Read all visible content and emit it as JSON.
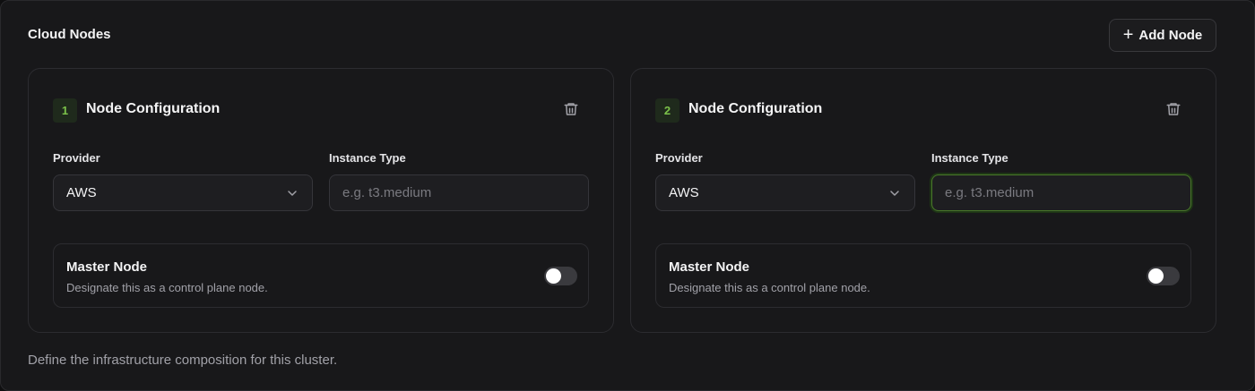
{
  "section": {
    "title": "Cloud Nodes",
    "add_button_label": "Add Node",
    "footer": "Define the infrastructure composition for this cluster."
  },
  "colors": {
    "accent_green": "#7cc24a",
    "background": "#18181a"
  },
  "nodes": [
    {
      "index": "1",
      "title": "Node Configuration",
      "provider_label": "Provider",
      "provider_value": "AWS",
      "instance_label": "Instance Type",
      "instance_placeholder": "e.g. t3.medium",
      "instance_value": "",
      "master_title": "Master Node",
      "master_desc": "Designate this as a control plane node.",
      "master_enabled": false
    },
    {
      "index": "2",
      "title": "Node Configuration",
      "provider_label": "Provider",
      "provider_value": "AWS",
      "instance_label": "Instance Type",
      "instance_placeholder": "e.g. t3.medium",
      "instance_value": "",
      "master_title": "Master Node",
      "master_desc": "Designate this as a control plane node.",
      "master_enabled": false
    }
  ],
  "icons": {
    "add": "plus-icon",
    "delete": "trash-icon",
    "dropdown": "chevron-down-icon"
  }
}
